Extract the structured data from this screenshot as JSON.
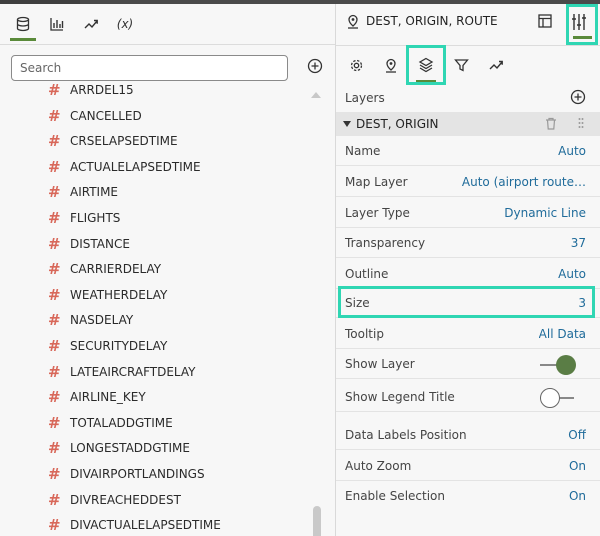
{
  "left": {
    "tabs": [
      {
        "name": "data-icon"
      },
      {
        "name": "visualizations-icon"
      },
      {
        "name": "analytics-icon"
      },
      {
        "label": "(x)"
      }
    ],
    "search_placeholder": "Search",
    "fields": [
      "ARRDEL15",
      "CANCELLED",
      "CRSELAPSEDTIME",
      "ACTUALELAPSEDTIME",
      "AIRTIME",
      "FLIGHTS",
      "DISTANCE",
      "CARRIERDELAY",
      "WEATHERDELAY",
      "NASDELAY",
      "SECURITYDELAY",
      "LATEAIRCRAFTDELAY",
      "AIRLINE_KEY",
      "TOTALADDGTIME",
      "LONGESTADDGTIME",
      "DIVAIRPORTLANDINGS",
      "DIVREACHEDDEST",
      "DIVACTUALELAPSEDTIME"
    ],
    "field_glyph": "#"
  },
  "right": {
    "title": "DEST, ORIGIN, ROUTE",
    "layers_label": "Layers",
    "layer_name": "DEST, ORIGIN",
    "props": [
      {
        "k": "Name",
        "v": "Auto"
      },
      {
        "k": "Map Layer",
        "v": "Auto (airport route…"
      },
      {
        "k": "Layer Type",
        "v": "Dynamic Line"
      },
      {
        "k": "Transparency",
        "v": "37"
      },
      {
        "k": "Outline",
        "v": "Auto"
      },
      {
        "k": "Size",
        "v": "3"
      },
      {
        "k": "Tooltip",
        "v": "All Data"
      },
      {
        "k": "Show Layer",
        "toggle": "on"
      },
      {
        "k": "Show Legend Title",
        "toggle": "off"
      },
      {
        "k": "Data Labels Position",
        "v": "Off"
      },
      {
        "k": "Auto Zoom",
        "v": "On"
      },
      {
        "k": "Enable Selection",
        "v": "On"
      }
    ]
  },
  "colors": {
    "accent": "#5a8a3a",
    "highlight": "#2fd6b3",
    "link": "#1f6b9a",
    "hash": "#d8685a"
  }
}
